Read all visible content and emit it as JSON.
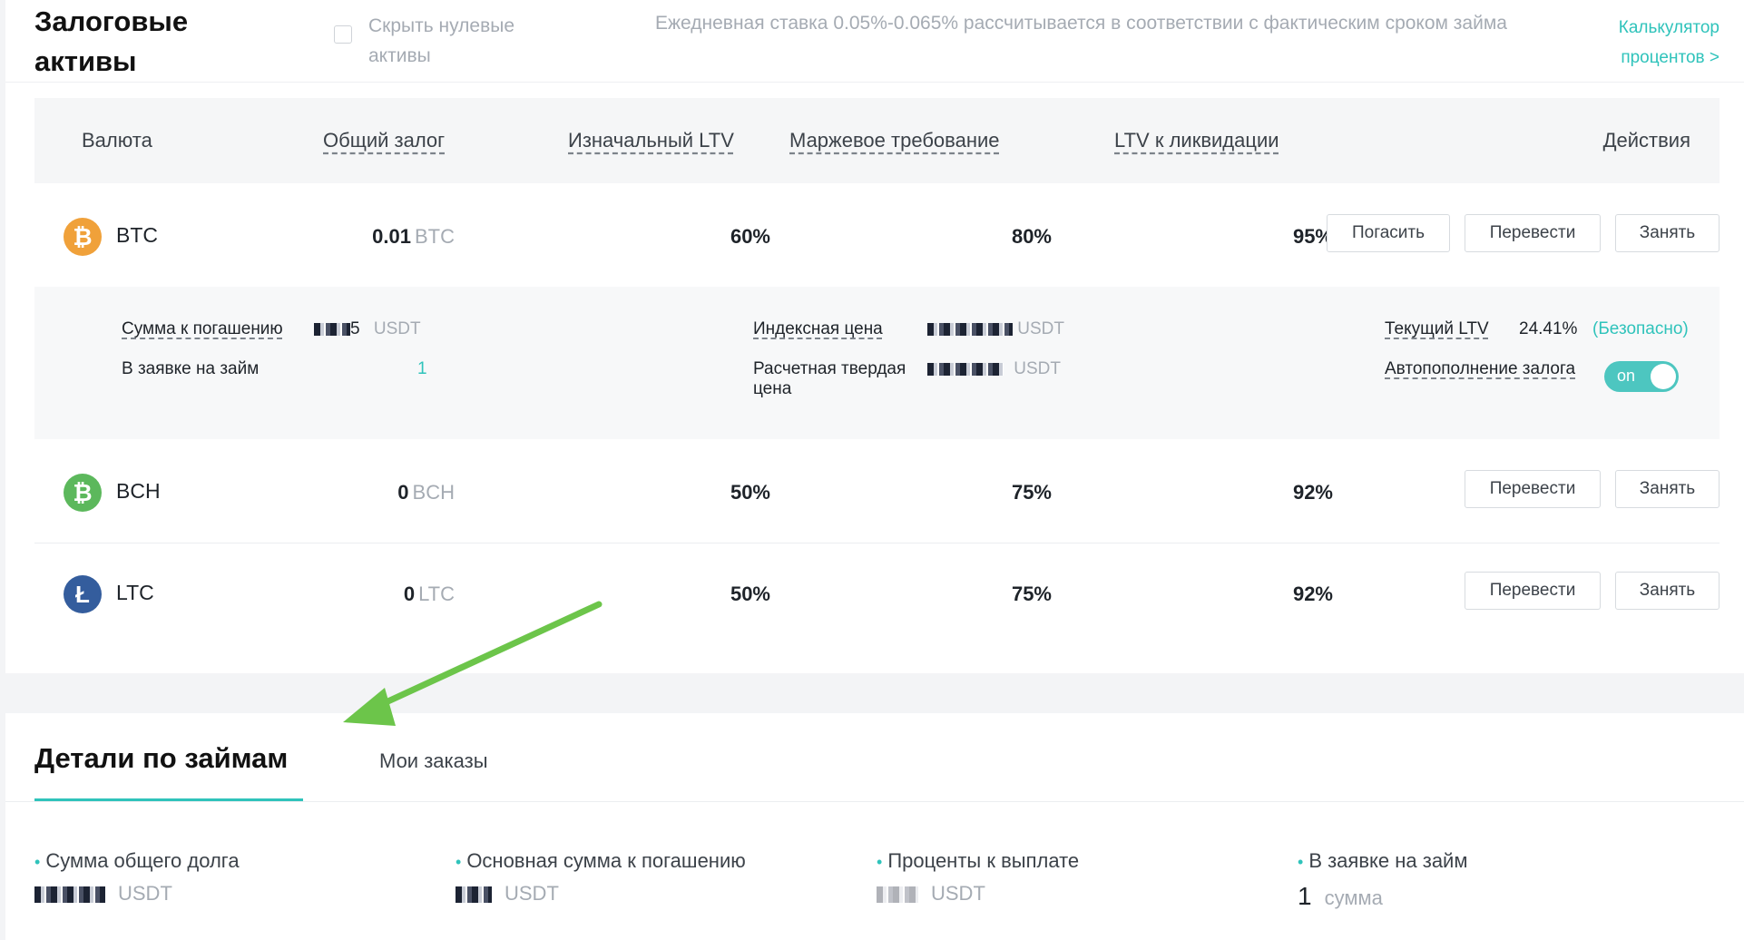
{
  "header": {
    "title": "Залоговые активы",
    "hide_zero_label": "Скрыть нулевые активы",
    "rate_note": "Ежедневная ставка 0.05%-0.065% рассчитывается в соответствии с фактическим сроком займа",
    "calc_link": "Калькулятор процентов  >"
  },
  "table": {
    "columns": {
      "currency": "Валюта",
      "total_collateral": "Общий залог",
      "initial_ltv": "Изначальный LTV",
      "margin_req": "Маржевое требование",
      "liq_ltv": "LTV к ликвидации",
      "actions": "Действия"
    },
    "rows": [
      {
        "coin": "BTC",
        "amount": "0.01",
        "unit": "BTC",
        "initial_ltv": "60%",
        "margin": "80%",
        "liq": "95%",
        "btn_repay": "Погасить",
        "btn_transfer": "Перевести",
        "btn_borrow": "Занять",
        "icon_color": "#f0a13a"
      },
      {
        "coin": "BCH",
        "amount": "0",
        "unit": "BCH",
        "initial_ltv": "50%",
        "margin": "75%",
        "liq": "92%",
        "btn_transfer": "Перевести",
        "btn_borrow": "Занять",
        "icon_color": "#5cb85c"
      },
      {
        "coin": "LTC",
        "amount": "0",
        "unit": "LTC",
        "initial_ltv": "50%",
        "margin": "75%",
        "liq": "92%",
        "btn_transfer": "Перевести",
        "btn_borrow": "Занять",
        "icon_color": "#345d9d"
      }
    ]
  },
  "detail": {
    "repay_label": "Сумма к погашению",
    "repay_visible_suffix": "5",
    "repay_unit": "USDT",
    "loan_request_label": "В заявке на займ",
    "loan_request_value": "1",
    "index_price_label": "Индексная цена",
    "index_price_unit": "USDT",
    "settle_price_label": "Расчетная твердая цена",
    "settle_price_unit": "USDT",
    "current_ltv_label": "Текущий LTV",
    "current_ltv_value": "24.41%",
    "current_ltv_status": "(Безопасно)",
    "auto_topup_label": "Автопополнение залога",
    "auto_topup_state": "on"
  },
  "tabs": {
    "active": "Детали по займам",
    "inactive": "Мои заказы"
  },
  "stats": [
    {
      "label": "Сумма общего долга",
      "unit": "USDT"
    },
    {
      "label": "Основная сумма к погашению",
      "unit": "USDT"
    },
    {
      "label": "Проценты к выплате",
      "unit": "USDT"
    },
    {
      "label": "В заявке на займ",
      "value": "1",
      "unit": "сумма"
    }
  ],
  "colors": {
    "accent": "#2fc3bb",
    "annotation_arrow": "#6cc54a"
  }
}
